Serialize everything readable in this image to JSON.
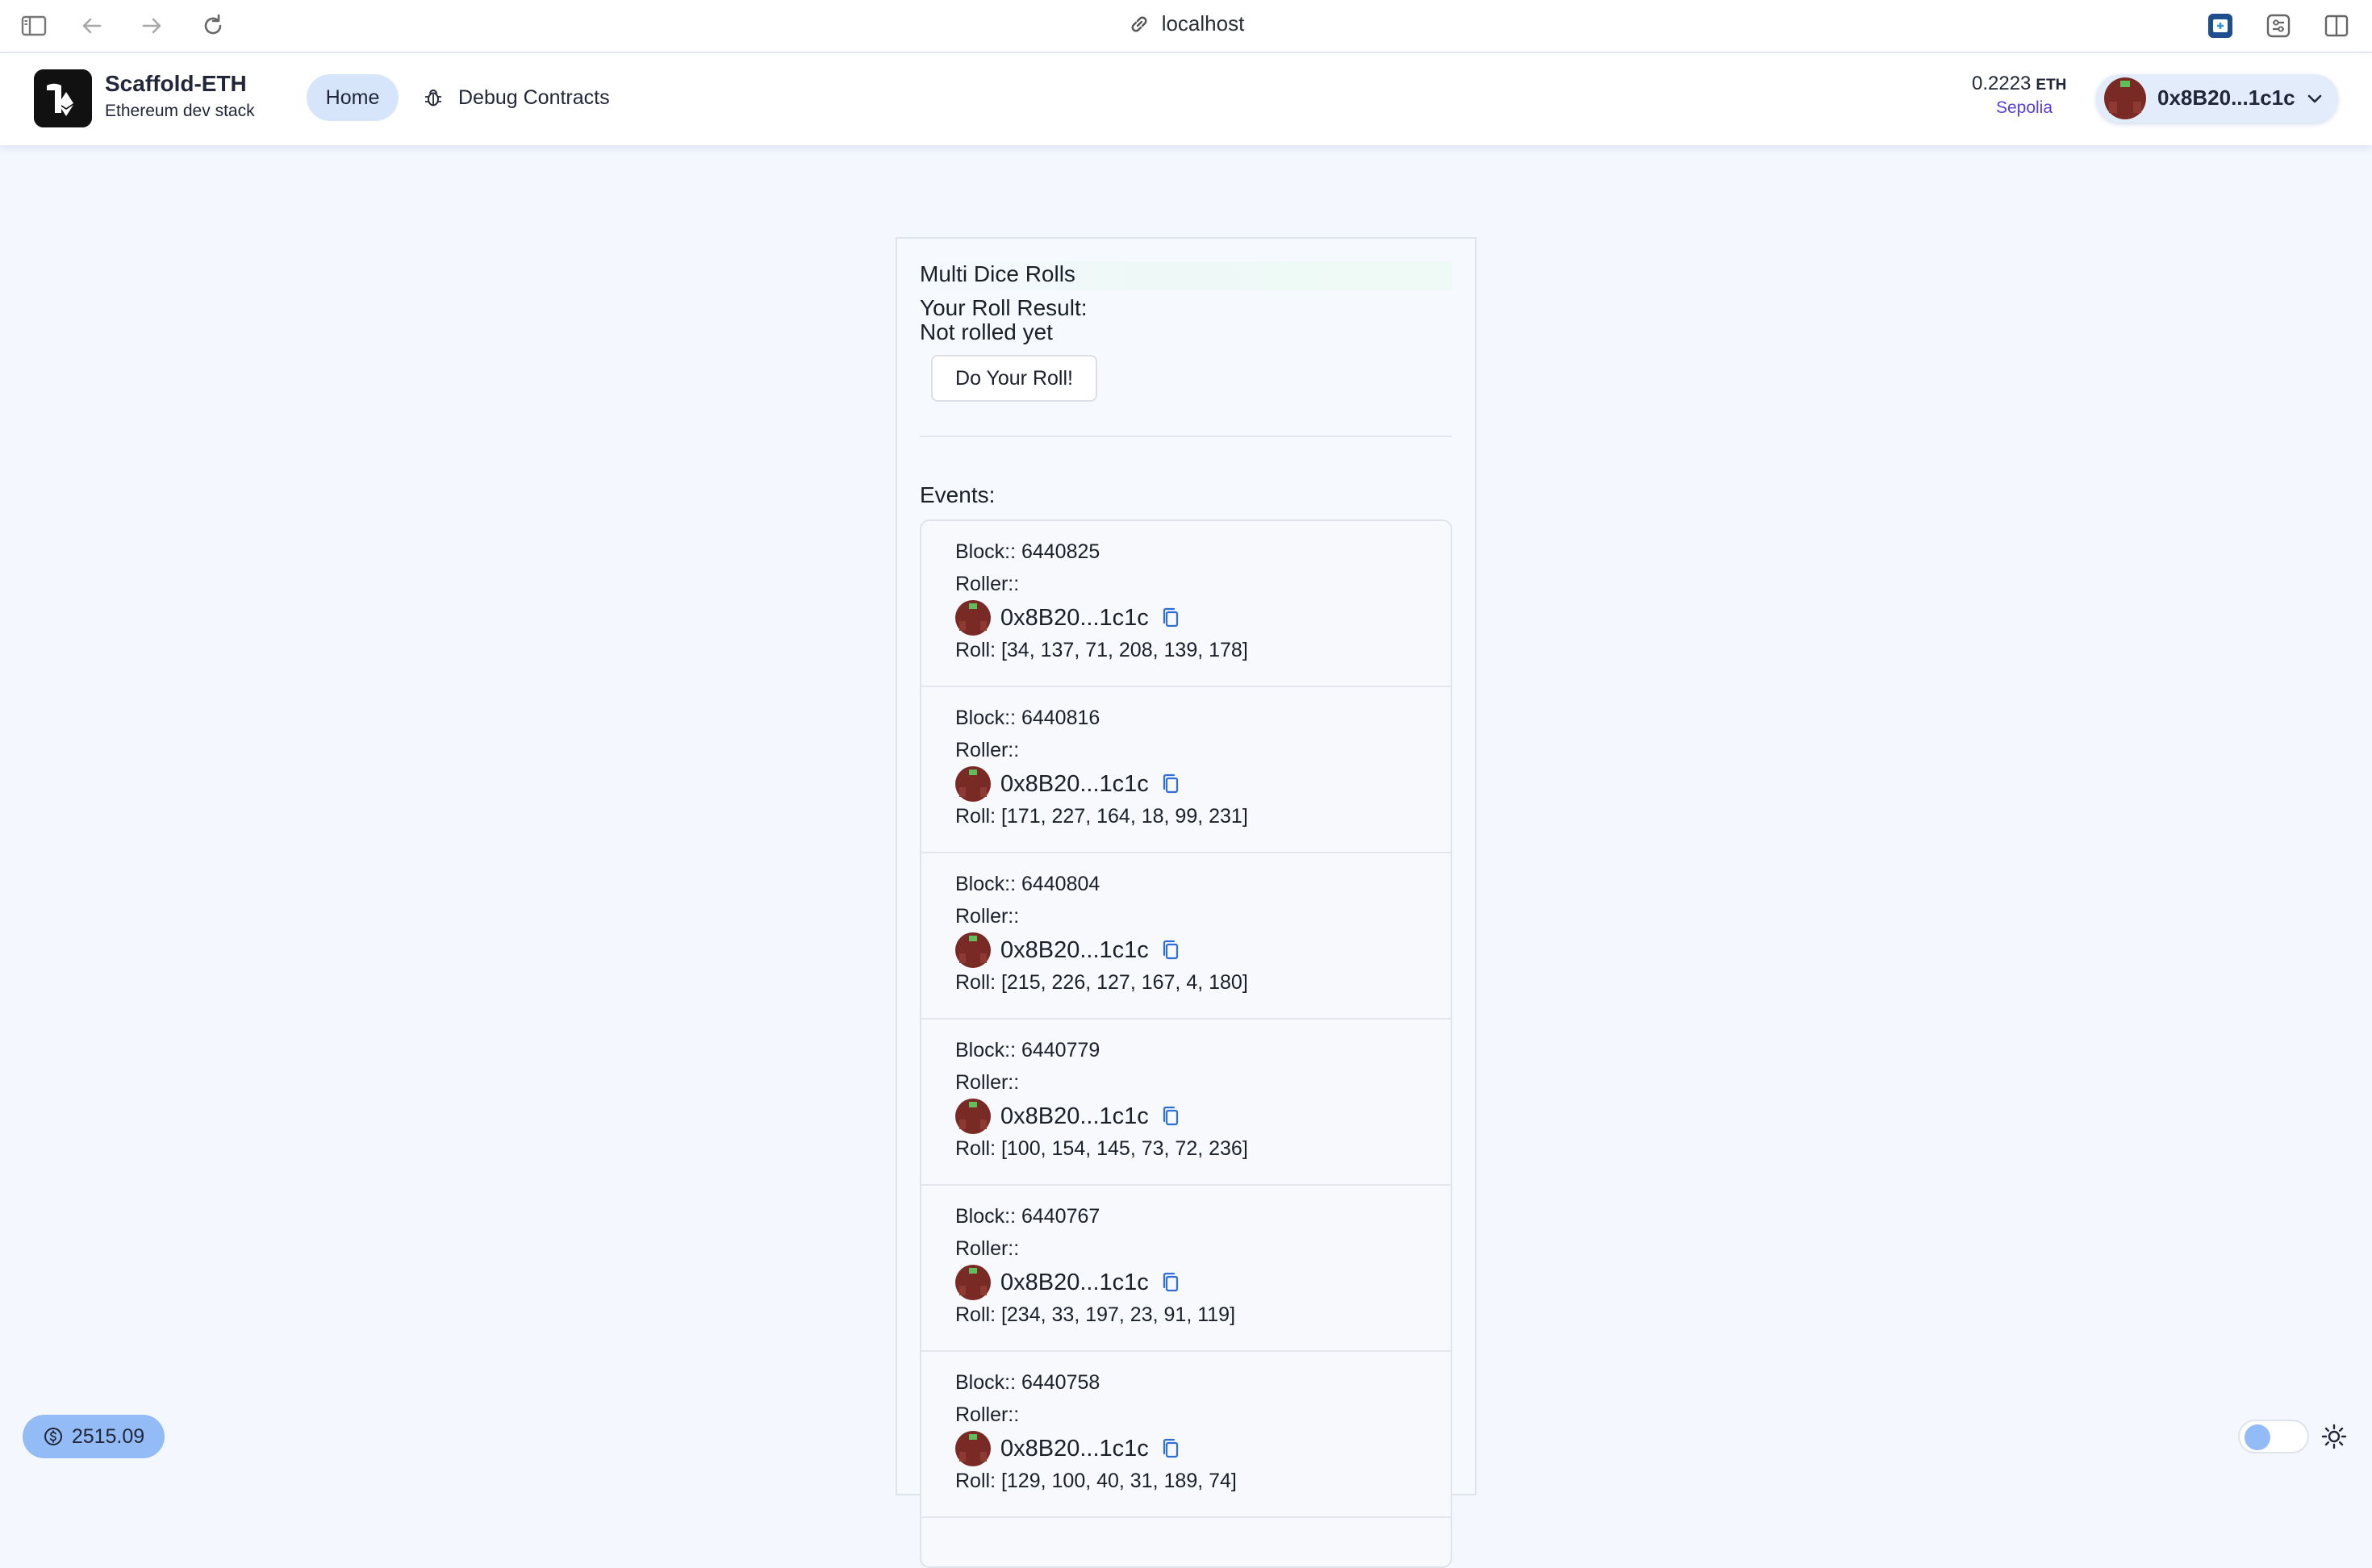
{
  "browser": {
    "url": "localhost"
  },
  "brand": {
    "title": "Scaffold-ETH",
    "subtitle": "Ethereum dev stack"
  },
  "nav": {
    "home": "Home",
    "debug": "Debug Contracts"
  },
  "wallet": {
    "balance": "0.2223",
    "unit": "ETH",
    "network": "Sepolia",
    "address": "0x8B20...1c1c"
  },
  "card": {
    "title": "Multi Dice Rolls",
    "result_label": "Your Roll Result:",
    "result_value": "Not rolled yet",
    "roll_button": "Do Your Roll!",
    "events_label": "Events:"
  },
  "events": [
    {
      "block": "Block:: 6440825",
      "roller_label": "Roller::",
      "address": "0x8B20...1c1c",
      "roll": "Roll: [34, 137, 71, 208, 139, 178]"
    },
    {
      "block": "Block:: 6440816",
      "roller_label": "Roller::",
      "address": "0x8B20...1c1c",
      "roll": "Roll: [171, 227, 164, 18, 99, 231]"
    },
    {
      "block": "Block:: 6440804",
      "roller_label": "Roller::",
      "address": "0x8B20...1c1c",
      "roll": "Roll: [215, 226, 127, 167, 4, 180]"
    },
    {
      "block": "Block:: 6440779",
      "roller_label": "Roller::",
      "address": "0x8B20...1c1c",
      "roll": "Roll: [100, 154, 145, 73, 72, 236]"
    },
    {
      "block": "Block:: 6440767",
      "roller_label": "Roller::",
      "address": "0x8B20...1c1c",
      "roll": "Roll: [234, 33, 197, 23, 91, 119]"
    },
    {
      "block": "Block:: 6440758",
      "roller_label": "Roller::",
      "address": "0x8B20...1c1c",
      "roll": "Roll: [129, 100, 40, 31, 189, 74]"
    }
  ],
  "footer": {
    "eth_price": "2515.09"
  },
  "colors": {
    "accent": "#93bbf5",
    "nav_active": "#d7e5fb",
    "network": "#5b3fd1",
    "avatar": "#7a2a24",
    "copy_icon": "#2f6fd6"
  },
  "icons": {
    "sidebar_toggle": "sidebar-icon",
    "back": "arrow-left-icon",
    "forward": "arrow-right-icon",
    "reload": "reload-icon",
    "link": "link-icon",
    "debug": "bug-icon",
    "copy": "copy-icon",
    "price": "dollar-icon",
    "theme": "sun-icon"
  }
}
